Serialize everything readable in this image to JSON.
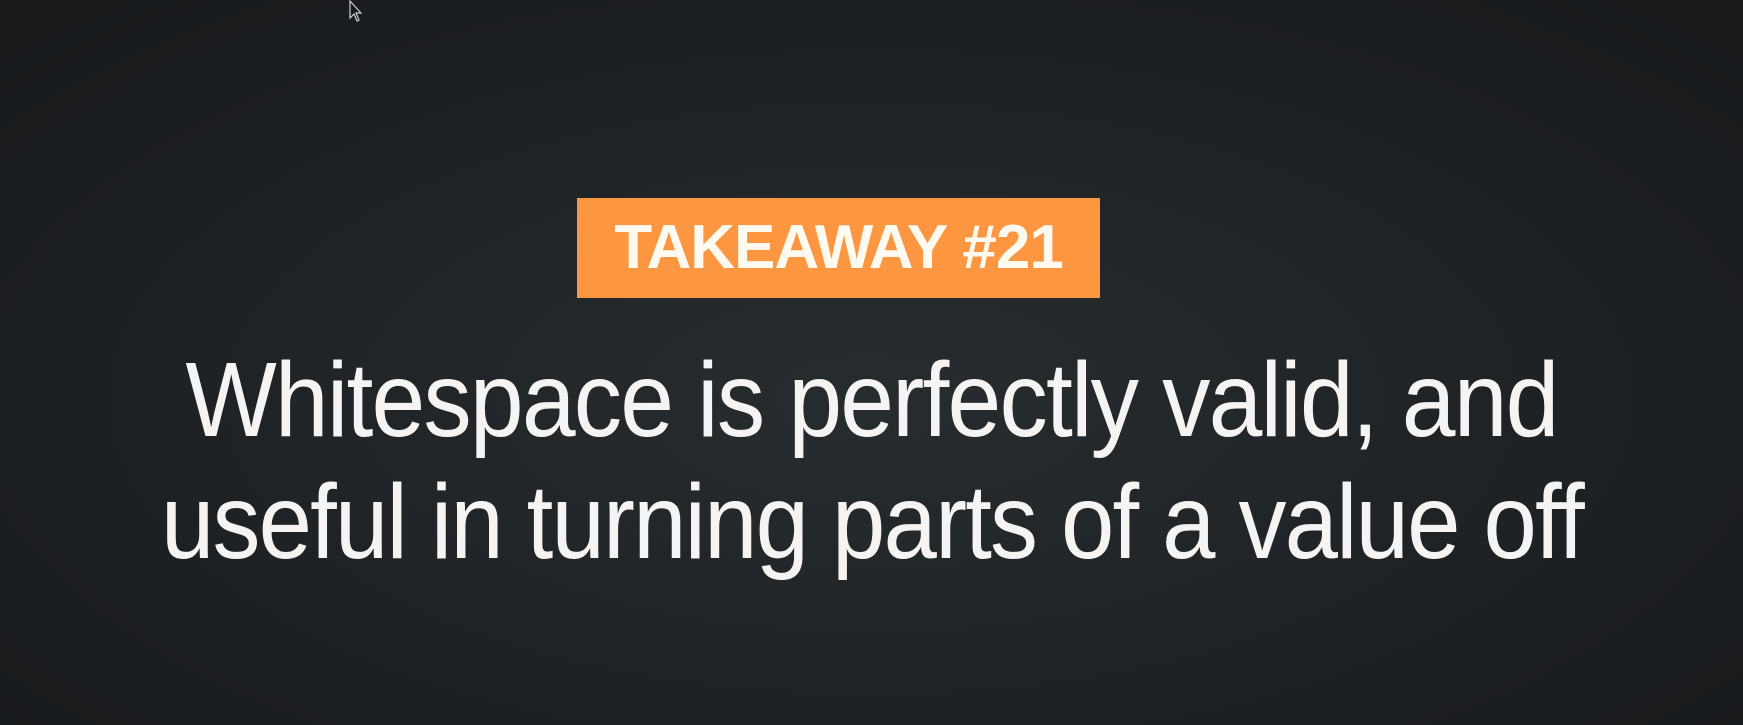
{
  "slide": {
    "badge_label": "TAKEAWAY #21",
    "lines": [
      "Whitespace is perfectly valid, and",
      "useful in turning parts of a value off"
    ]
  },
  "colors": {
    "badge": "#fc9641",
    "background": "#202427",
    "text": "#f4f4f4"
  },
  "icons": {
    "pointer": "mouse-pointer-icon"
  }
}
